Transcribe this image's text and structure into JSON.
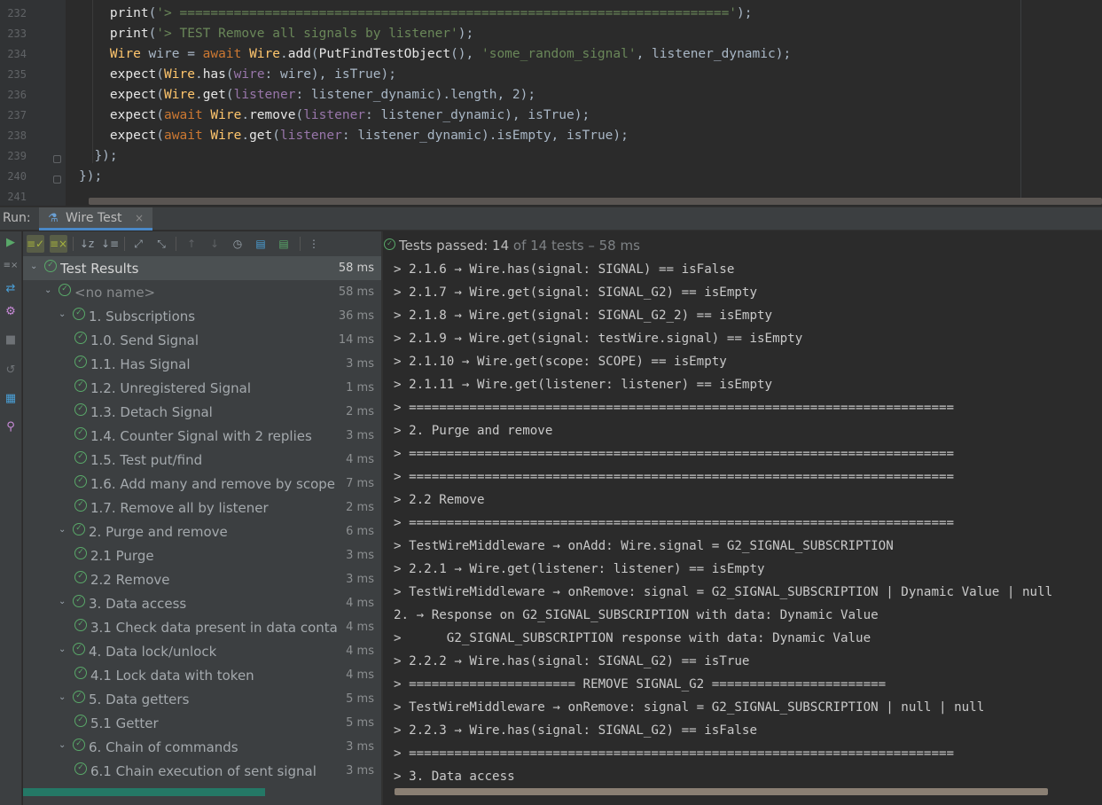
{
  "editor": {
    "lines": [
      {
        "n": "232",
        "indent": 4,
        "parts": [
          [
            "fn",
            "print"
          ],
          [
            "p",
            "("
          ],
          [
            "str",
            "'> ======================================================================='"
          ],
          [
            "p",
            ");"
          ]
        ]
      },
      {
        "n": "233",
        "indent": 4,
        "parts": [
          [
            "fn",
            "print"
          ],
          [
            "p",
            "("
          ],
          [
            "str",
            "'> TEST Remove all signals by listener'"
          ],
          [
            "p",
            ");"
          ]
        ]
      },
      {
        "n": "234",
        "indent": 4,
        "parts": [
          [
            "cls",
            "Wire"
          ],
          [
            "p",
            " wire = "
          ],
          [
            "kw",
            "await "
          ],
          [
            "cls",
            "Wire"
          ],
          [
            "p",
            "."
          ],
          [
            "fn",
            "add"
          ],
          [
            "p",
            "("
          ],
          [
            "fn",
            "PutFindTestObject"
          ],
          [
            "p",
            "(), "
          ],
          [
            "str",
            "'some_random_signal'"
          ],
          [
            "p",
            ", listener_dynamic);"
          ]
        ]
      },
      {
        "n": "235",
        "indent": 4,
        "parts": [
          [
            "fn",
            "expect"
          ],
          [
            "p",
            "("
          ],
          [
            "cls",
            "Wire"
          ],
          [
            "p",
            "."
          ],
          [
            "fn",
            "has"
          ],
          [
            "p",
            "("
          ],
          [
            "prm",
            "wire"
          ],
          [
            "p",
            ": wire), isTrue);"
          ]
        ]
      },
      {
        "n": "236",
        "indent": 4,
        "parts": [
          [
            "fn",
            "expect"
          ],
          [
            "p",
            "("
          ],
          [
            "cls",
            "Wire"
          ],
          [
            "p",
            "."
          ],
          [
            "fn",
            "get"
          ],
          [
            "p",
            "("
          ],
          [
            "prm",
            "listener"
          ],
          [
            "p",
            ": listener_dynamic).length, 2);"
          ]
        ]
      },
      {
        "n": "237",
        "indent": 4,
        "parts": [
          [
            "fn",
            "expect"
          ],
          [
            "p",
            "("
          ],
          [
            "kw",
            "await "
          ],
          [
            "cls",
            "Wire"
          ],
          [
            "p",
            "."
          ],
          [
            "fn",
            "remove"
          ],
          [
            "p",
            "("
          ],
          [
            "prm",
            "listener"
          ],
          [
            "p",
            ": listener_dynamic), isTrue);"
          ]
        ]
      },
      {
        "n": "238",
        "indent": 4,
        "parts": [
          [
            "fn",
            "expect"
          ],
          [
            "p",
            "("
          ],
          [
            "kw",
            "await "
          ],
          [
            "cls",
            "Wire"
          ],
          [
            "p",
            "."
          ],
          [
            "fn",
            "get"
          ],
          [
            "p",
            "("
          ],
          [
            "prm",
            "listener"
          ],
          [
            "p",
            ": listener_dynamic).isEmpty, isTrue);"
          ]
        ]
      },
      {
        "n": "239",
        "indent": 2,
        "parts": [
          [
            "p",
            "});"
          ]
        ]
      },
      {
        "n": "240",
        "indent": 0,
        "parts": [
          [
            "p",
            "});"
          ]
        ]
      },
      {
        "n": "241",
        "indent": 0,
        "parts": []
      }
    ]
  },
  "run": {
    "label": "Run:",
    "tab_label": "Wire Test",
    "tab_close": "×"
  },
  "status": {
    "passed": "Tests passed: 14",
    "rest": " of 14 tests – 58 ms"
  },
  "tree": [
    {
      "level": 0,
      "label": "Test Results",
      "time": "58 ms",
      "chevron": true,
      "selected": true,
      "style": "root"
    },
    {
      "level": 1,
      "label": "<no name>",
      "time": "58 ms",
      "chevron": true,
      "style": "grey"
    },
    {
      "level": 2,
      "label": "1. Subscriptions",
      "time": "36 ms",
      "chevron": true
    },
    {
      "level": 3,
      "label": "1.0. Send Signal",
      "time": "14 ms"
    },
    {
      "level": 3,
      "label": "1.1. Has Signal",
      "time": "3 ms"
    },
    {
      "level": 3,
      "label": "1.2. Unregistered Signal",
      "time": "1 ms"
    },
    {
      "level": 3,
      "label": "1.3. Detach Signal",
      "time": "2 ms"
    },
    {
      "level": 3,
      "label": "1.4. Counter Signal with 2 replies",
      "time": "3 ms"
    },
    {
      "level": 3,
      "label": "1.5. Test put/find",
      "time": "4 ms"
    },
    {
      "level": 3,
      "label": "1.6. Add many and remove by scope",
      "time": "7 ms"
    },
    {
      "level": 3,
      "label": "1.7. Remove all by listener",
      "time": "2 ms"
    },
    {
      "level": 2,
      "label": "2. Purge and remove",
      "time": "6 ms",
      "chevron": true
    },
    {
      "level": 3,
      "label": "2.1 Purge",
      "time": "3 ms"
    },
    {
      "level": 3,
      "label": "2.2 Remove",
      "time": "3 ms"
    },
    {
      "level": 2,
      "label": "3. Data access",
      "time": "4 ms",
      "chevron": true
    },
    {
      "level": 3,
      "label": "3.1 Check data present in data conta",
      "time": "4 ms"
    },
    {
      "level": 2,
      "label": "4. Data lock/unlock",
      "time": "4 ms",
      "chevron": true
    },
    {
      "level": 3,
      "label": "4.1 Lock data with token",
      "time": "4 ms"
    },
    {
      "level": 2,
      "label": "5. Data getters",
      "time": "5 ms",
      "chevron": true
    },
    {
      "level": 3,
      "label": "5.1 Getter",
      "time": "5 ms"
    },
    {
      "level": 2,
      "label": "6. Chain of commands",
      "time": "3 ms",
      "chevron": true
    },
    {
      "level": 3,
      "label": "6.1 Chain execution of sent signal",
      "time": "3 ms"
    }
  ],
  "console": [
    "> 2.1.6 → Wire.has(signal: SIGNAL) == isFalse",
    "> 2.1.7 → Wire.get(signal: SIGNAL_G2) == isEmpty",
    "> 2.1.8 → Wire.get(signal: SIGNAL_G2_2) == isEmpty",
    "> 2.1.9 → Wire.get(signal: testWire.signal) == isEmpty",
    "> 2.1.10 → Wire.get(scope: SCOPE) == isEmpty",
    "> 2.1.11 → Wire.get(listener: listener) == isEmpty",
    "> ========================================================================",
    "> 2. Purge and remove",
    "> ========================================================================",
    "> ========================================================================",
    "> 2.2 Remove",
    "> ========================================================================",
    "> TestWireMiddleware → onAdd: Wire.signal = G2_SIGNAL_SUBSCRIPTION",
    "> 2.2.1 → Wire.get(listener: listener) == isEmpty",
    "> TestWireMiddleware → onRemove: signal = G2_SIGNAL_SUBSCRIPTION | Dynamic Value | null",
    "2. → Response on G2_SIGNAL_SUBSCRIPTION with data: Dynamic Value",
    ">      G2_SIGNAL_SUBSCRIPTION response with data: Dynamic Value",
    "> 2.2.2 → Wire.has(signal: SIGNAL_G2) == isTrue",
    "> ====================== REMOVE SIGNAL_G2 =======================",
    "> TestWireMiddleware → onRemove: signal = G2_SIGNAL_SUBSCRIPTION | null | null",
    "> 2.2.3 → Wire.has(signal: SIGNAL_G2) == isFalse",
    "> ========================================================================",
    "> 3. Data access"
  ],
  "colors": {
    "accent": "#4a88c7",
    "pass": "#59a869",
    "background": "#2b2b2b",
    "panel": "#3c3f41"
  }
}
